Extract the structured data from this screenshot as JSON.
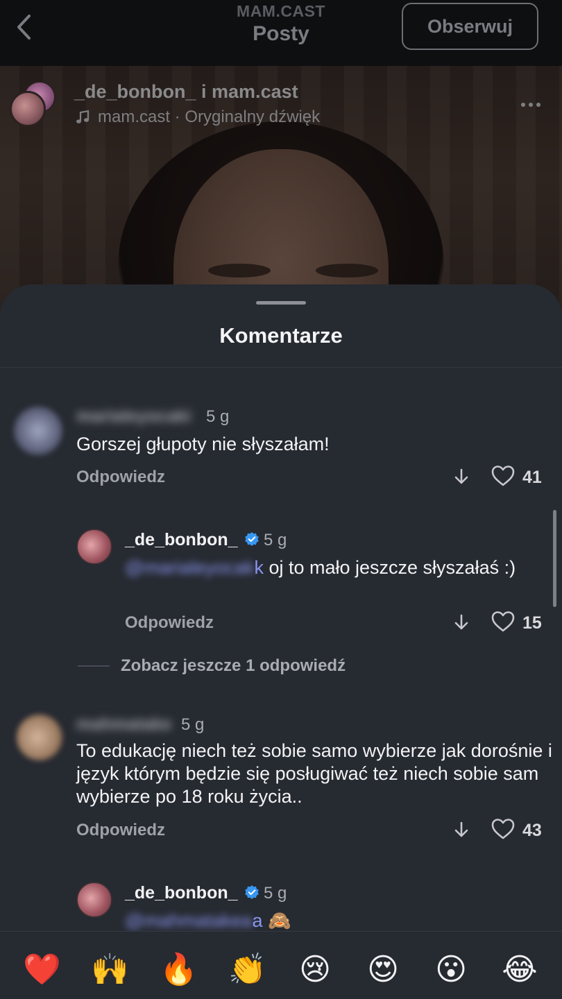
{
  "header": {
    "subtitle": "MAM.CAST",
    "title": "Posty",
    "follow_label": "Obserwuj"
  },
  "post": {
    "authors_a": "_de_bonbon_",
    "authors_joiner": " i ",
    "authors_b": "mam.cast",
    "audio": "mam.cast · Oryginalny dźwięk"
  },
  "sheet": {
    "title": "Komentarze",
    "more_replies": "Zobacz jeszcze 1 odpowiedź"
  },
  "comments": [
    {
      "username": "marialeyocaki",
      "age": "5 g",
      "text": "Gorszej głupoty nie słyszałam!",
      "reply_label": "Odpowiedz",
      "likes": "41"
    },
    {
      "username": "_de_bonbon_",
      "age": "5 g",
      "mention": "@marialeyocak",
      "mention_tail": "k",
      "text": " oj to mało jeszcze słyszałaś :)",
      "reply_label": "Odpowiedz",
      "likes": "15"
    },
    {
      "username": "mahmatake",
      "age": "5 g",
      "text": "To edukację  niech też sobie samo wybierze jak dorośnie i  język którym będzie się posługiwać też niech sobie sam wybierze po 18 roku życia..",
      "reply_label": "Odpowiedz",
      "likes": "43"
    },
    {
      "username": "_de_bonbon_",
      "age": "5 g",
      "mention": "@mahmatakea",
      "mention_tail": "a",
      "text": " 🙈"
    }
  ],
  "emoji_bar": [
    "❤️",
    "🙌",
    "🔥",
    "👏",
    "😢",
    "😍",
    "😮",
    "😂"
  ],
  "icons": {
    "back": "chevron-left-icon",
    "audio": "music-note-icon",
    "verified": "verified-badge-icon",
    "downvote": "arrow-down-icon",
    "like": "heart-outline-icon"
  },
  "colors": {
    "sheet_bg": "#262a31",
    "mention": "#8a95ef",
    "verified": "#3897f0"
  }
}
